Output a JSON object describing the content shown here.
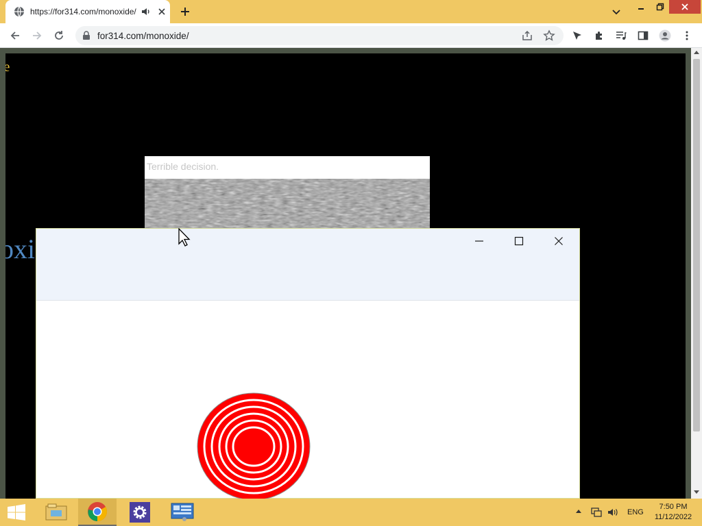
{
  "browser": {
    "tab": {
      "title": "https://for314.com/monoxide/",
      "favicon": "globe-icon",
      "audio_icon": "speaker-icon"
    },
    "toolbar": {
      "url": "for314.com/monoxide/",
      "icons": [
        "back-icon",
        "forward-icon",
        "reload-icon",
        "lock-icon",
        "share-icon",
        "star-icon",
        "cursor-extension-icon",
        "puzzle-icon",
        "media-icon",
        "sidepanel-icon",
        "profile-icon",
        "kebab-icon"
      ]
    },
    "colors": {
      "frame": "#f0c863",
      "close": "#c7463a"
    }
  },
  "page": {
    "fragment_top": "le",
    "fragment_title": "oxide",
    "background": "#000000"
  },
  "popup": {
    "text": "Terrible decision."
  },
  "fg_window": {
    "controls": [
      "minimize-icon",
      "maximize-icon",
      "close-icon"
    ],
    "target_colors": {
      "ring": "#ff0000",
      "gap": "#ffffff"
    }
  },
  "taskbar": {
    "apps": [
      "windows-start-icon",
      "file-explorer-icon",
      "chrome-icon",
      "settings-icon",
      "control-panel-icon"
    ],
    "tray": [
      "network-icon",
      "volume-icon"
    ],
    "lang": "ENG",
    "time": "7:50 PM",
    "date": "11/12/2022"
  }
}
